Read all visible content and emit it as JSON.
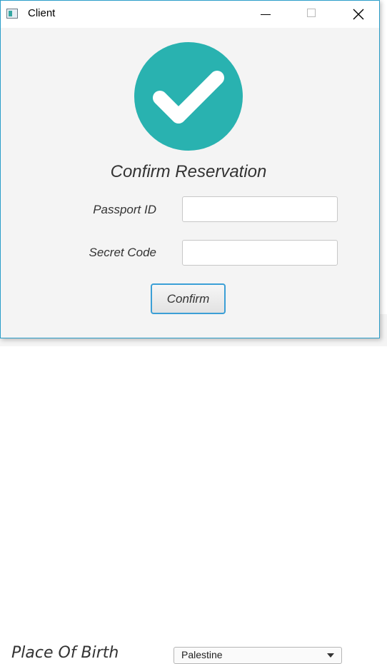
{
  "window": {
    "title": "Client"
  },
  "dialog": {
    "heading": "Confirm Reservation",
    "fields": [
      {
        "label": "Passport ID",
        "value": "",
        "placeholder": ""
      },
      {
        "label": "Secret Code",
        "value": "",
        "placeholder": ""
      }
    ],
    "confirm_label": "Confirm",
    "icon": "check-circle-icon"
  },
  "background_app": {
    "field_label": "Place Of Birth",
    "select_value": "Palestine"
  },
  "colors": {
    "accent_teal": "#29b2b0",
    "focus_blue": "#3b9fd6",
    "window_border": "#2b9ec9"
  }
}
